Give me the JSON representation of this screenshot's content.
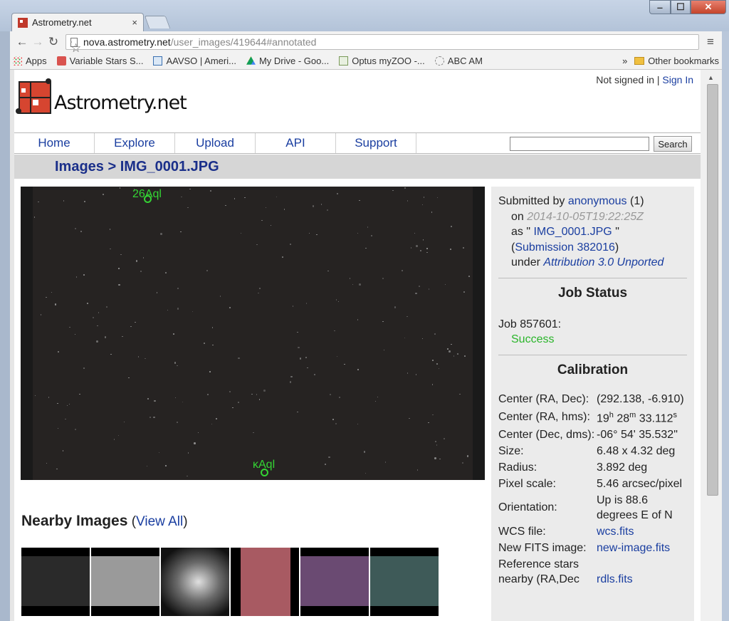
{
  "browser": {
    "tab_title": "Astrometry.net",
    "tab_close": "×",
    "url_host": "nova.astrometry.net",
    "url_path": "/user_images/419644#annotated",
    "bookmarks": [
      {
        "label": "Apps"
      },
      {
        "label": "Variable Stars S..."
      },
      {
        "label": "AAVSO | Ameri..."
      },
      {
        "label": "My Drive - Goo..."
      },
      {
        "label": "Optus myZOO -..."
      },
      {
        "label": "ABC AM"
      }
    ],
    "bookmarks_overflow": "»",
    "other_bookmarks": "Other bookmarks"
  },
  "header": {
    "not_signed_in": "Not signed in | ",
    "sign_in": "Sign In",
    "logo_text": "Astrometry.net"
  },
  "nav": {
    "items": [
      "Home",
      "Explore",
      "Upload",
      "API",
      "Support"
    ],
    "search_button": "Search"
  },
  "breadcrumb": {
    "section": "Images",
    "separator": " > ",
    "current": "IMG_0001.JPG"
  },
  "image": {
    "annotations": [
      {
        "label": "26Aql"
      },
      {
        "label": "κAql"
      }
    ]
  },
  "nearby": {
    "title": "Nearby Images",
    "view_all_open": " (",
    "view_all": "View All",
    "view_all_close": ")",
    "thumb_colors": [
      "#2a2a2a",
      "#9a9a9a",
      "#6a6a6a",
      "#a85a62",
      "#6a4a72",
      "#3e5a58"
    ]
  },
  "submission": {
    "submitted_by": "Submitted by ",
    "user": "anonymous",
    "user_count": " (1)",
    "on": "on ",
    "date": "2014-10-05T19:22:25Z",
    "as_prefix": "as \" ",
    "filename": "IMG_0001.JPG",
    "as_suffix": " \"",
    "submission_open": "(",
    "submission_link": "Submission 382016",
    "submission_close": ")",
    "under": "under ",
    "license": "Attribution 3.0 Unported"
  },
  "job_status": {
    "title": "Job Status",
    "job": "Job 857601:",
    "status": "Success"
  },
  "calibration": {
    "title": "Calibration",
    "center_radec_k": "Center (RA, Dec):",
    "center_radec_v": "(292.138, -6.910)",
    "center_hms_k": "Center (RA, hms):",
    "ra_h": "19",
    "ra_m": "28",
    "ra_s": "33.112",
    "center_dms_k": "Center (Dec, dms):",
    "center_dms_v": "-06° 54' 35.532\"",
    "size_k": "Size:",
    "size_v": "6.48 x 4.32 deg",
    "radius_k": "Radius:",
    "radius_v": "3.892 deg",
    "pixscale_k": "Pixel scale:",
    "pixscale_v": "5.46 arcsec/pixel",
    "orientation_k": "Orientation:",
    "orientation_v": "Up is 88.6 degrees E of N",
    "wcs_k": "WCS file:",
    "wcs_v": "wcs.fits",
    "newfits_k": "New FITS image:",
    "newfits_v": "new-image.fits",
    "refstars_k": "Reference stars nearby (RA,Dec",
    "refstars_v": "rdls.fits"
  }
}
